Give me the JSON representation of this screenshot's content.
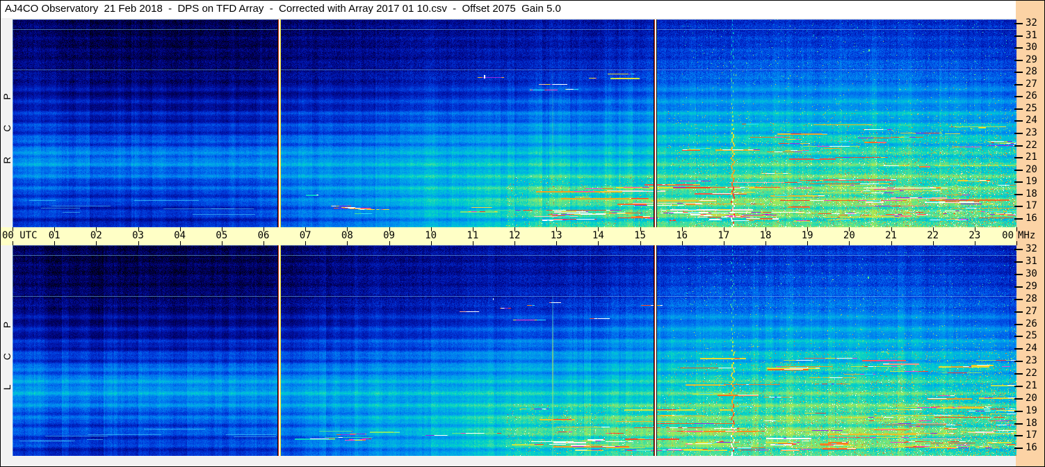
{
  "title": "AJ4CO Observatory  21 Feb 2018  -  DPS on TFD Array  -  Corrected with Array 2017 01 10.csv  -  Offset 2075  Gain 5.0",
  "colors": {
    "background": "#f2f2f2",
    "titlebar_bg": "#ffffff",
    "time_axis_bg": "#ffffc6",
    "freq_axis_bg": "#fcd3a5",
    "text": "#000000"
  },
  "chart_data": {
    "type": "heatmap",
    "title": "AJ4CO Observatory  21 Feb 2018  -  DPS on TFD Array  -  Corrected with Array 2017 01 10.csv  -  Offset 2075  Gain 5.0",
    "xlabel": "UTC",
    "y_unit": "MHz",
    "x_range_hours": [
      0,
      24
    ],
    "y_range_mhz": [
      16,
      32
    ],
    "x_ticks": [
      "00 UTC",
      "01",
      "02",
      "03",
      "04",
      "05",
      "06",
      "07",
      "08",
      "09",
      "10",
      "11",
      "12",
      "13",
      "14",
      "15",
      "16",
      "17",
      "18",
      "19",
      "20",
      "21",
      "22",
      "23",
      "00"
    ],
    "y_ticks": [
      32,
      31,
      30,
      29,
      28,
      27,
      26,
      25,
      24,
      23,
      22,
      21,
      20,
      19,
      18,
      17,
      16
    ],
    "grid_hours": [
      0,
      2,
      4,
      6,
      8,
      10,
      12,
      14,
      16,
      18,
      20,
      22,
      24
    ],
    "grid_freqs_mhz": [
      32,
      31,
      30,
      29,
      28,
      27,
      26,
      25,
      24,
      23,
      22,
      21,
      20,
      19,
      18,
      17,
      16
    ],
    "series": [
      {
        "name": "RCP",
        "label": "R C P",
        "intensity": [
          [
            0.1,
            0.07,
            0.07,
            0.09,
            0.13,
            0.16,
            0.18,
            0.2,
            0.24,
            0.26,
            0.27,
            0.26,
            0.22
          ],
          [
            0.11,
            0.08,
            0.08,
            0.1,
            0.14,
            0.17,
            0.19,
            0.21,
            0.26,
            0.28,
            0.29,
            0.28,
            0.23
          ],
          [
            0.12,
            0.09,
            0.09,
            0.11,
            0.15,
            0.18,
            0.2,
            0.22,
            0.28,
            0.31,
            0.32,
            0.3,
            0.25
          ],
          [
            0.13,
            0.1,
            0.1,
            0.12,
            0.16,
            0.19,
            0.22,
            0.24,
            0.31,
            0.34,
            0.35,
            0.33,
            0.27
          ],
          [
            0.15,
            0.12,
            0.12,
            0.14,
            0.18,
            0.21,
            0.24,
            0.27,
            0.34,
            0.37,
            0.38,
            0.36,
            0.3
          ],
          [
            0.17,
            0.14,
            0.14,
            0.16,
            0.2,
            0.24,
            0.27,
            0.3,
            0.38,
            0.41,
            0.42,
            0.4,
            0.33
          ],
          [
            0.2,
            0.17,
            0.17,
            0.19,
            0.23,
            0.27,
            0.31,
            0.34,
            0.42,
            0.45,
            0.46,
            0.44,
            0.37
          ],
          [
            0.23,
            0.2,
            0.2,
            0.22,
            0.27,
            0.31,
            0.35,
            0.38,
            0.46,
            0.49,
            0.5,
            0.48,
            0.41
          ],
          [
            0.26,
            0.23,
            0.23,
            0.26,
            0.31,
            0.36,
            0.4,
            0.43,
            0.49,
            0.52,
            0.53,
            0.51,
            0.45
          ],
          [
            0.3,
            0.27,
            0.28,
            0.3,
            0.35,
            0.41,
            0.45,
            0.47,
            0.52,
            0.55,
            0.56,
            0.54,
            0.48
          ],
          [
            0.36,
            0.34,
            0.35,
            0.37,
            0.41,
            0.46,
            0.49,
            0.51,
            0.55,
            0.58,
            0.59,
            0.57,
            0.51
          ],
          [
            0.44,
            0.42,
            0.43,
            0.45,
            0.48,
            0.52,
            0.54,
            0.55,
            0.58,
            0.61,
            0.62,
            0.6,
            0.54
          ],
          [
            0.42,
            0.4,
            0.41,
            0.44,
            0.48,
            0.53,
            0.56,
            0.58,
            0.6,
            0.63,
            0.64,
            0.62,
            0.56
          ],
          [
            0.34,
            0.32,
            0.33,
            0.37,
            0.45,
            0.52,
            0.58,
            0.61,
            0.62,
            0.65,
            0.66,
            0.64,
            0.58
          ],
          [
            0.31,
            0.29,
            0.3,
            0.35,
            0.45,
            0.53,
            0.6,
            0.64,
            0.65,
            0.67,
            0.68,
            0.66,
            0.6
          ],
          [
            0.29,
            0.27,
            0.28,
            0.33,
            0.44,
            0.53,
            0.61,
            0.66,
            0.68,
            0.69,
            0.7,
            0.68,
            0.62
          ],
          [
            0.26,
            0.24,
            0.25,
            0.3,
            0.4,
            0.49,
            0.57,
            0.62,
            0.64,
            0.65,
            0.66,
            0.64,
            0.58
          ]
        ]
      },
      {
        "name": "LCP",
        "label": "L C P",
        "intensity": [
          [
            0.09,
            0.06,
            0.06,
            0.08,
            0.13,
            0.16,
            0.18,
            0.2,
            0.24,
            0.26,
            0.27,
            0.26,
            0.22
          ],
          [
            0.1,
            0.07,
            0.07,
            0.09,
            0.14,
            0.17,
            0.19,
            0.21,
            0.26,
            0.28,
            0.29,
            0.28,
            0.23
          ],
          [
            0.11,
            0.08,
            0.08,
            0.1,
            0.15,
            0.18,
            0.2,
            0.22,
            0.28,
            0.31,
            0.32,
            0.3,
            0.25
          ],
          [
            0.12,
            0.09,
            0.09,
            0.11,
            0.16,
            0.19,
            0.22,
            0.24,
            0.31,
            0.34,
            0.35,
            0.33,
            0.27
          ],
          [
            0.14,
            0.11,
            0.11,
            0.13,
            0.18,
            0.21,
            0.24,
            0.27,
            0.34,
            0.37,
            0.38,
            0.36,
            0.3
          ],
          [
            0.16,
            0.13,
            0.13,
            0.15,
            0.2,
            0.24,
            0.27,
            0.3,
            0.38,
            0.41,
            0.42,
            0.4,
            0.33
          ],
          [
            0.19,
            0.16,
            0.16,
            0.18,
            0.23,
            0.27,
            0.31,
            0.34,
            0.42,
            0.45,
            0.46,
            0.44,
            0.37
          ],
          [
            0.22,
            0.19,
            0.19,
            0.21,
            0.27,
            0.31,
            0.35,
            0.38,
            0.46,
            0.49,
            0.5,
            0.48,
            0.41
          ],
          [
            0.27,
            0.24,
            0.24,
            0.27,
            0.31,
            0.36,
            0.4,
            0.43,
            0.49,
            0.52,
            0.53,
            0.51,
            0.45
          ],
          [
            0.33,
            0.3,
            0.31,
            0.33,
            0.36,
            0.41,
            0.45,
            0.47,
            0.52,
            0.55,
            0.56,
            0.54,
            0.48
          ],
          [
            0.41,
            0.39,
            0.4,
            0.41,
            0.43,
            0.46,
            0.49,
            0.51,
            0.55,
            0.58,
            0.59,
            0.57,
            0.51
          ],
          [
            0.48,
            0.46,
            0.47,
            0.48,
            0.5,
            0.52,
            0.54,
            0.55,
            0.58,
            0.61,
            0.62,
            0.6,
            0.54
          ],
          [
            0.46,
            0.44,
            0.45,
            0.47,
            0.5,
            0.53,
            0.56,
            0.58,
            0.6,
            0.63,
            0.64,
            0.62,
            0.56
          ],
          [
            0.38,
            0.36,
            0.37,
            0.4,
            0.46,
            0.52,
            0.58,
            0.61,
            0.62,
            0.65,
            0.66,
            0.64,
            0.58
          ],
          [
            0.34,
            0.32,
            0.33,
            0.37,
            0.46,
            0.53,
            0.6,
            0.64,
            0.65,
            0.67,
            0.68,
            0.66,
            0.6
          ],
          [
            0.32,
            0.3,
            0.31,
            0.35,
            0.45,
            0.53,
            0.61,
            0.66,
            0.68,
            0.69,
            0.7,
            0.68,
            0.62
          ],
          [
            0.28,
            0.26,
            0.27,
            0.31,
            0.41,
            0.49,
            0.57,
            0.62,
            0.64,
            0.65,
            0.66,
            0.64,
            0.58
          ]
        ]
      }
    ],
    "features": {
      "data_gap_hours": [
        6.37,
        15.36
      ],
      "interference_sweep_hour": 17.22,
      "lcp_vertical_line_hour": 12.9,
      "persistent_lines_mhz": [
        31.5,
        28.2
      ],
      "bright_points": {
        "rcp": [
          [
            11.27,
            27.6,
            2,
            5,
            "#ffffff"
          ],
          [
            20.47,
            29.8,
            2,
            3,
            "#64ff96"
          ]
        ],
        "lcp": [
          [
            11.5,
            28.0,
            1,
            3,
            "#d2ffff"
          ],
          [
            20.45,
            29.7,
            2,
            3,
            "#50ff82"
          ]
        ]
      },
      "colormap": [
        [
          0.0,
          "#000010"
        ],
        [
          0.1,
          "#000064"
        ],
        [
          0.2,
          "#0014aa"
        ],
        [
          0.3,
          "#003cdc"
        ],
        [
          0.4,
          "#0078f0"
        ],
        [
          0.5,
          "#00aae8"
        ],
        [
          0.58,
          "#00d2c8"
        ],
        [
          0.66,
          "#50e196"
        ],
        [
          0.74,
          "#a0eb5a"
        ],
        [
          0.82,
          "#e6e132"
        ],
        [
          0.9,
          "#f59620"
        ],
        [
          0.96,
          "#f03c28"
        ],
        [
          1.0,
          "#ffffff"
        ]
      ],
      "gap_edge_colors": [
        "#000000",
        "#d23c28",
        "#fffff0",
        "#e6dc28"
      ],
      "streak_colors": [
        "#ffffff",
        "#ffffff",
        "#ff40c8",
        "#9628e6",
        "#ff3c28",
        "#ffdc28",
        "#28e6ff"
      ]
    }
  }
}
